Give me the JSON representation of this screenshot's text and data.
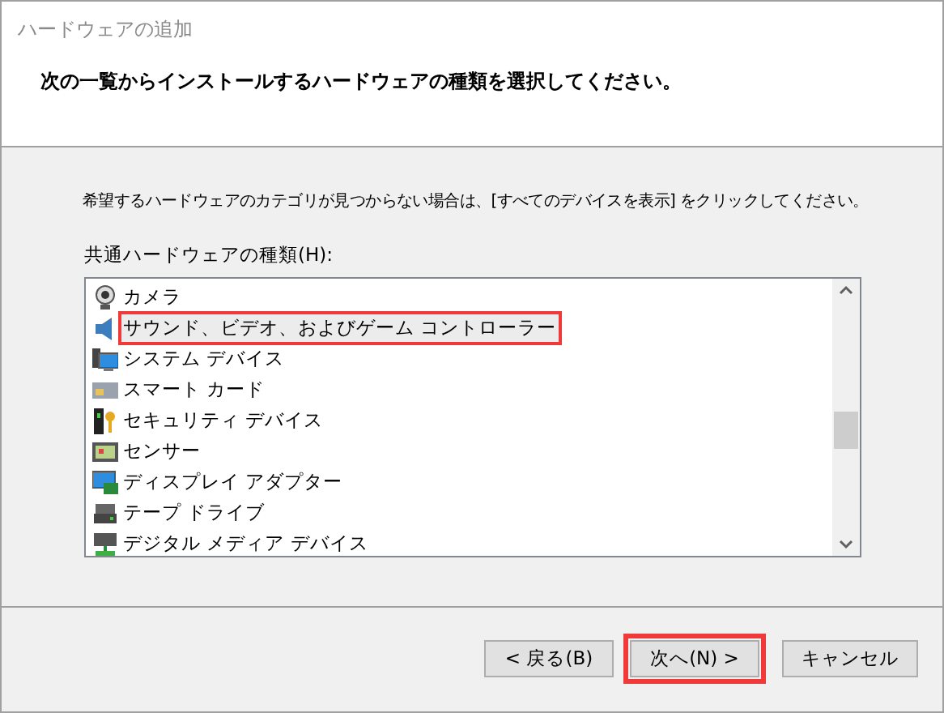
{
  "window": {
    "title": "ハードウェアの追加"
  },
  "header": {
    "instruction": "次の一覧からインストールするハードウェアの種類を選択してください。"
  },
  "hint": "希望するハードウェアのカテゴリが見つからない場合は、[すべてのデバイスを表示] をクリックしてください。",
  "list_label": "共通ハードウェアの種類(H):",
  "items": [
    {
      "label": "カメラ",
      "kind": "camera",
      "selected": false,
      "annotated": false
    },
    {
      "label": "サウンド、ビデオ、およびゲーム コントローラー",
      "kind": "speaker",
      "selected": true,
      "annotated": true
    },
    {
      "label": "システム デバイス",
      "kind": "system",
      "selected": false,
      "annotated": false
    },
    {
      "label": "スマート カード",
      "kind": "card",
      "selected": false,
      "annotated": false
    },
    {
      "label": "セキュリティ デバイス",
      "kind": "security",
      "selected": false,
      "annotated": false
    },
    {
      "label": "センサー",
      "kind": "sensor",
      "selected": false,
      "annotated": false
    },
    {
      "label": "ディスプレイ アダプター",
      "kind": "display",
      "selected": false,
      "annotated": false
    },
    {
      "label": "テープ ドライブ",
      "kind": "tape",
      "selected": false,
      "annotated": false
    },
    {
      "label": "デジタル メディア デバイス",
      "kind": "media",
      "selected": false,
      "annotated": false
    }
  ],
  "buttons": [
    {
      "label": "< 戻る(B)",
      "annotated": false
    },
    {
      "label": "次へ(N) >",
      "annotated": true
    },
    {
      "label": "キャンセル",
      "annotated": false
    }
  ]
}
